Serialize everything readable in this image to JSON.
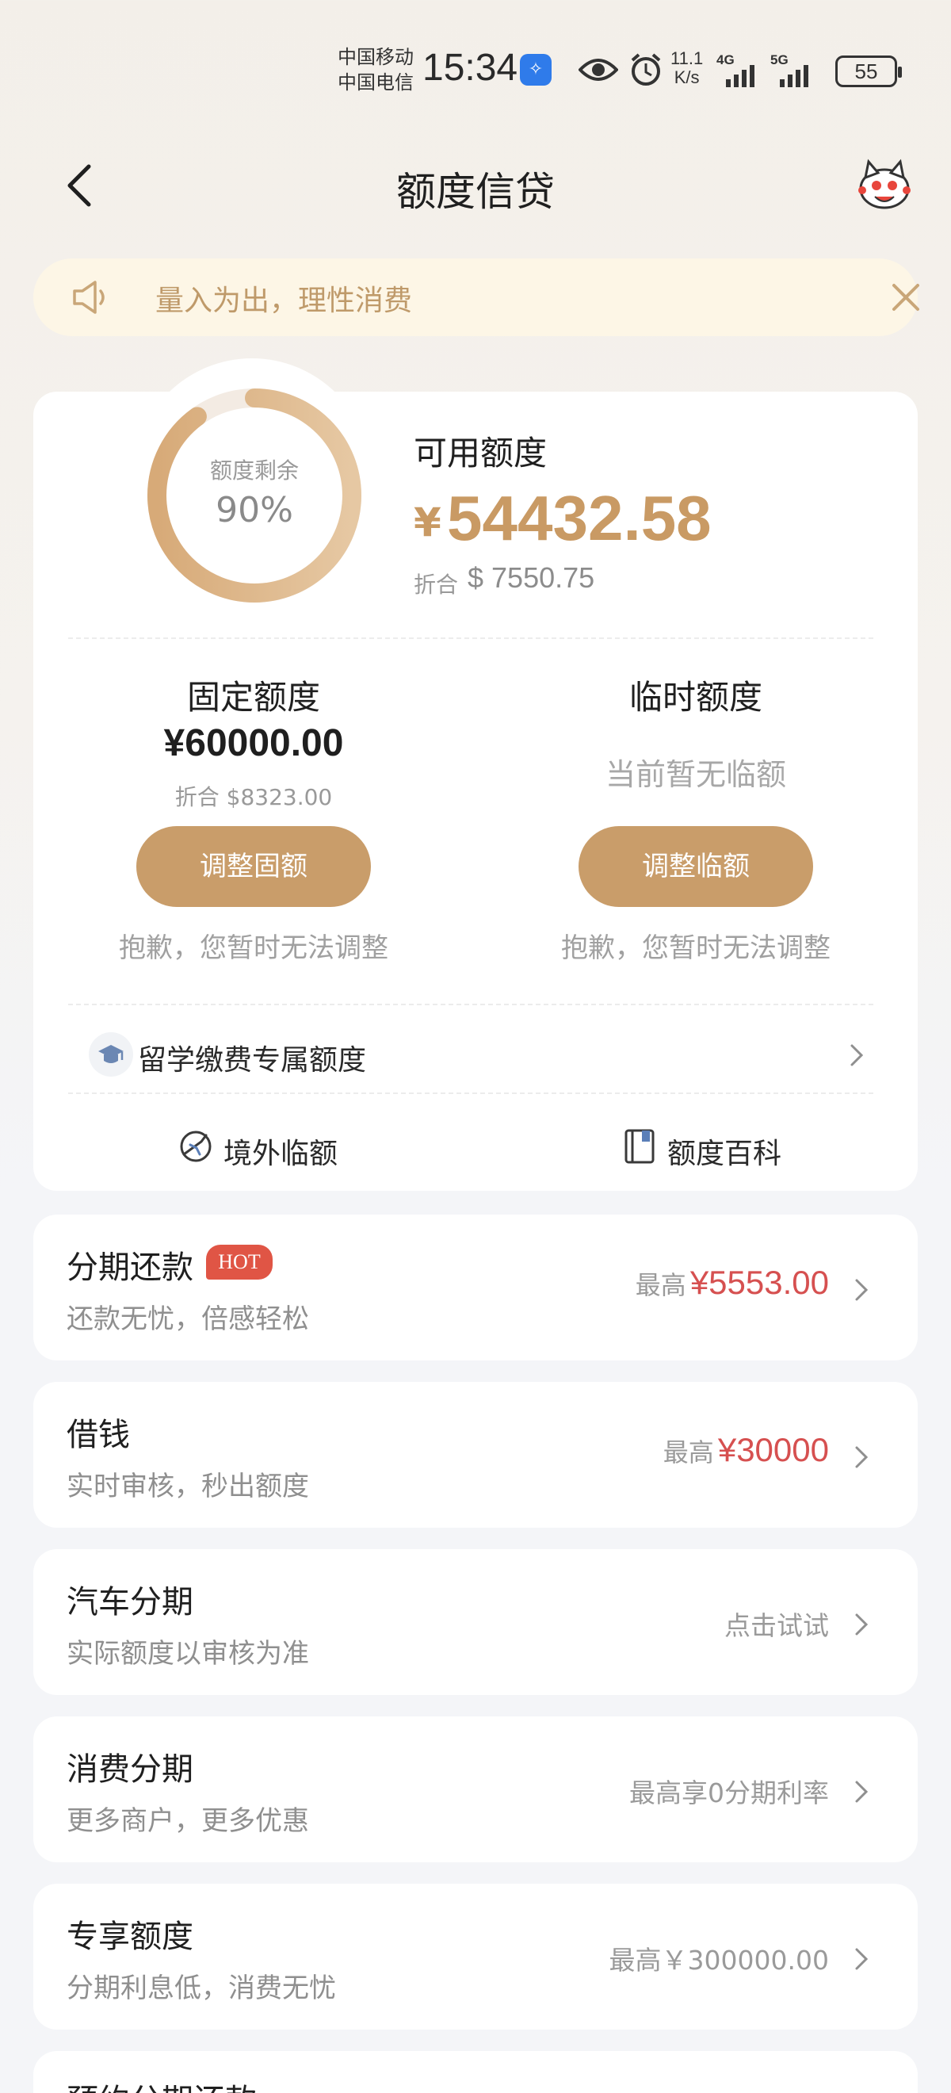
{
  "status_bar": {
    "carrier_1": "中国移动",
    "carrier_2": "中国电信",
    "time": "15:34",
    "net_speed_value": "11.1",
    "net_speed_unit": "K/s",
    "sim1_type": "4G",
    "sim2_type": "5G",
    "battery": "55"
  },
  "header": {
    "title": "额度信贷"
  },
  "notice": {
    "text": "量入为出，理性消费"
  },
  "summary": {
    "ring_label": "额度剩余",
    "ring_percent": "90%",
    "ring_fraction": 0.9,
    "available_title": "可用额度",
    "available_currency": "¥",
    "available_amount": "54432.58",
    "converted_label": "折合",
    "converted_value": "$ 7550.75",
    "accent_color": "#c99a64"
  },
  "fixed_limit": {
    "title": "固定额度",
    "amount": "¥60000.00",
    "converted": "折合 $8323.00",
    "button": "调整固额",
    "note": "抱歉，您暂时无法调整"
  },
  "temp_limit": {
    "title": "临时额度",
    "status": "当前暂无临额",
    "button": "调整临额",
    "note": "抱歉，您暂时无法调整"
  },
  "study_row": {
    "label": "留学缴费专属额度",
    "icon": "graduation-cap-icon"
  },
  "quick_links": [
    {
      "label": "境外临额",
      "icon": "globe-plane-icon"
    },
    {
      "label": "额度百科",
      "icon": "book-icon"
    }
  ],
  "products": [
    {
      "title": "分期还款",
      "badge": "HOT",
      "subtitle": "还款无忧，倍感轻松",
      "prefix": "最高",
      "value": "¥5553.00"
    },
    {
      "title": "借钱",
      "subtitle": "实时审核，秒出额度",
      "prefix": "最高",
      "value": "¥30000"
    },
    {
      "title": "汽车分期",
      "subtitle": "实际额度以审核为准",
      "plain": "点击试试"
    },
    {
      "title": "消费分期",
      "subtitle": "更多商户，更多优惠",
      "plain": "最高享0分期利率"
    },
    {
      "title": "专享额度",
      "subtitle": "分期利息低，消费无忧",
      "plain": "最高￥300000.00"
    },
    {
      "title": "预约分期还款"
    }
  ],
  "colors": {
    "brand_gold": "#c99d6a",
    "highlight_red": "#d65050",
    "hot_badge": "#e05545"
  }
}
